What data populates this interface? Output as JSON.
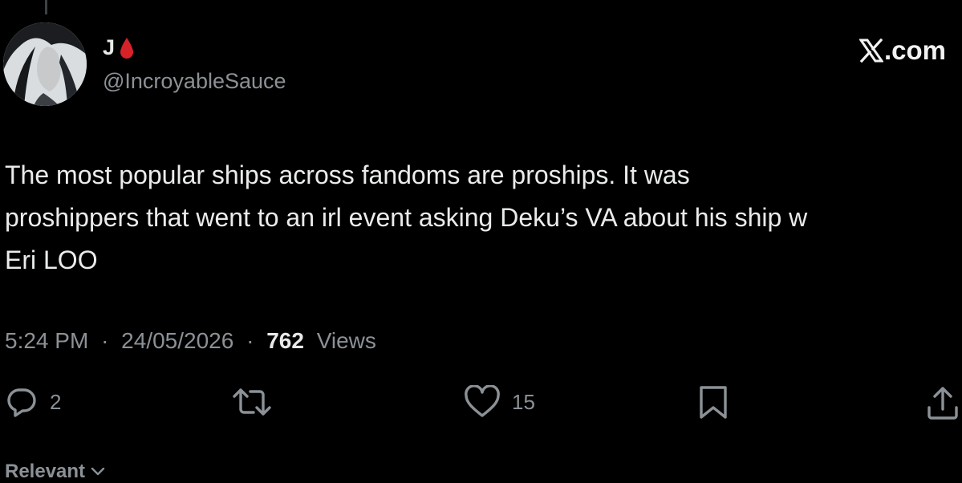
{
  "author": {
    "display_name": "J",
    "handle": "@IncroyableSauce",
    "badge_icon": "blood-drop-icon",
    "badge_color": "#d8222a"
  },
  "brand": {
    "label": ".com",
    "icon": "x-logo-icon"
  },
  "tweet": {
    "lines": [
      "The most popular ships across fandoms are proships. It was",
      "proshippers that went to an irl event asking Deku’s VA about his ship w",
      "Eri LOO"
    ]
  },
  "meta": {
    "time": "5:24 PM",
    "separator": "·",
    "date": "24/05/2026",
    "views_count": "762",
    "views_label": "Views"
  },
  "actions": {
    "reply_count": "2",
    "like_count": "15",
    "icons": [
      "reply-icon",
      "retweet-icon",
      "like-icon",
      "bookmark-icon",
      "share-icon"
    ]
  },
  "sort": {
    "label": "Relevant",
    "icon": "chevron-down-icon"
  },
  "colors": {
    "background": "#000000",
    "text": "#e7e9ea",
    "muted": "#8b9196"
  }
}
